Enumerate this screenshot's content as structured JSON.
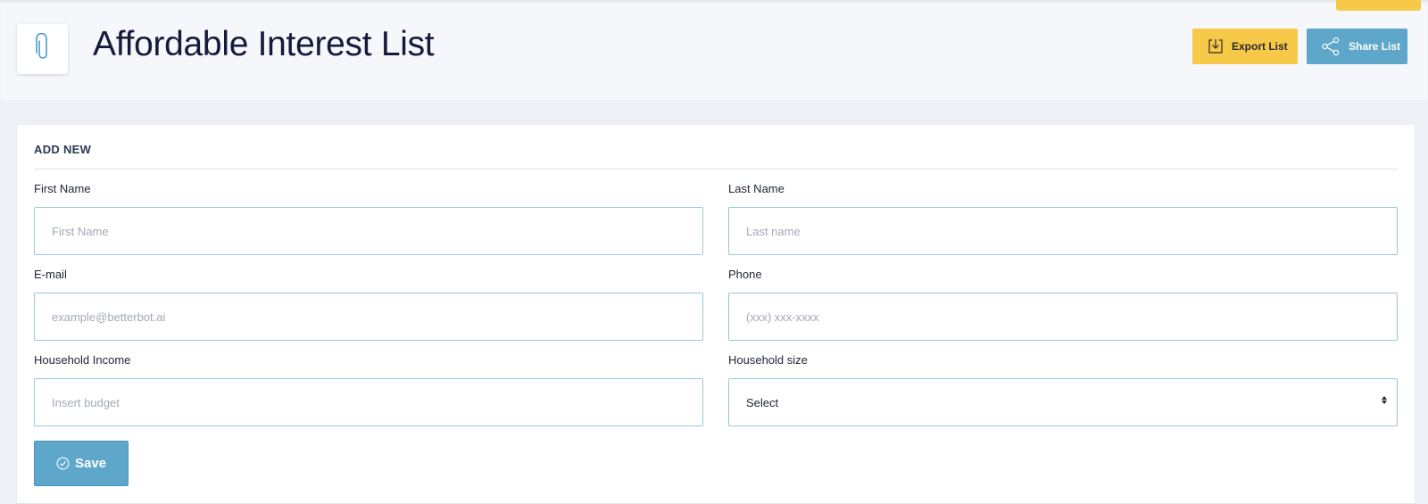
{
  "header": {
    "title": "Affordable Interest List",
    "logo_icon": "paperclip-icon",
    "export_label": "Export List",
    "export_icon": "download-icon",
    "share_label": "Share List",
    "share_icon": "share-icon"
  },
  "colors": {
    "accent_yellow": "#f7c948",
    "accent_blue": "#5ea7cb",
    "input_border": "#9cc7dc"
  },
  "form": {
    "section_title": "ADD NEW",
    "first_name": {
      "label": "First Name",
      "placeholder": "First Name",
      "value": ""
    },
    "last_name": {
      "label": "Last Name",
      "placeholder": "Last name",
      "value": ""
    },
    "email": {
      "label": "E-mail",
      "placeholder": "example@betterbot.ai",
      "value": ""
    },
    "phone": {
      "label": "Phone",
      "placeholder": "(xxx) xxx-xxxx",
      "value": ""
    },
    "household_income": {
      "label": "Household Income",
      "placeholder": "Insert budget",
      "value": ""
    },
    "household_size": {
      "label": "Household size",
      "selected": "Select"
    },
    "save_label": "Save",
    "save_icon": "check-circle-icon"
  }
}
